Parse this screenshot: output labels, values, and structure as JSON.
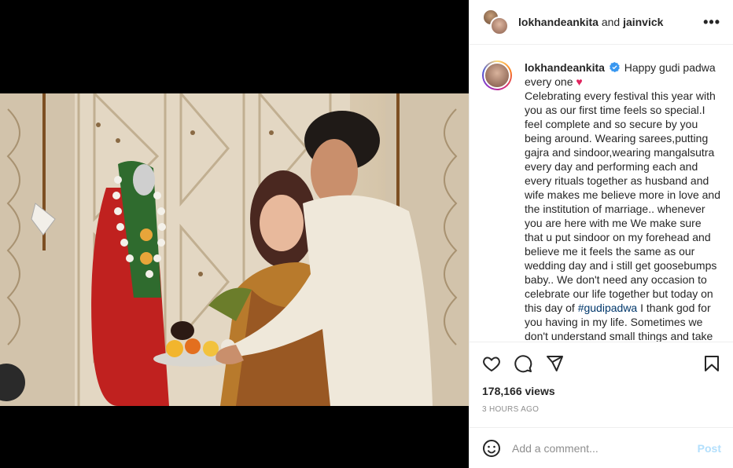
{
  "header": {
    "user1": "lokhandeankita",
    "conjunction": "and",
    "user2": "jainvick"
  },
  "caption": {
    "username": "lokhandeankita",
    "text_before_heart": "Happy gudi padwa every one ",
    "heart": "♥",
    "body": "Celebrating every festival this year with you as our first time feels so special.I feel complete and so secure by you being around. Wearing sarees,putting gajra and sindoor,wearing mangalsutra every day and performing each and every rituals together as husband and wife makes me believe more in love and the institution of marriage.. whenever you are here with me We make sure that u put sindoor on my forehead and believe me it feels the same as our wedding day and i still get goosebumps baby.. We don't need any occasion to celebrate our life together but today on this day of ",
    "hashtag": "#gudipadwa",
    "body_after": " I thank god for you having in my life. Sometimes we don't understand small things and take them for granted"
  },
  "stats": {
    "views": "178,166 views",
    "time": "3 HOURS AGO"
  },
  "comment": {
    "placeholder": "Add a comment...",
    "post_label": "Post"
  },
  "colors": {
    "link": "#00376b",
    "post_disabled": "#b2dffc",
    "heart": "#e0245e",
    "verified": "#3897f0"
  }
}
